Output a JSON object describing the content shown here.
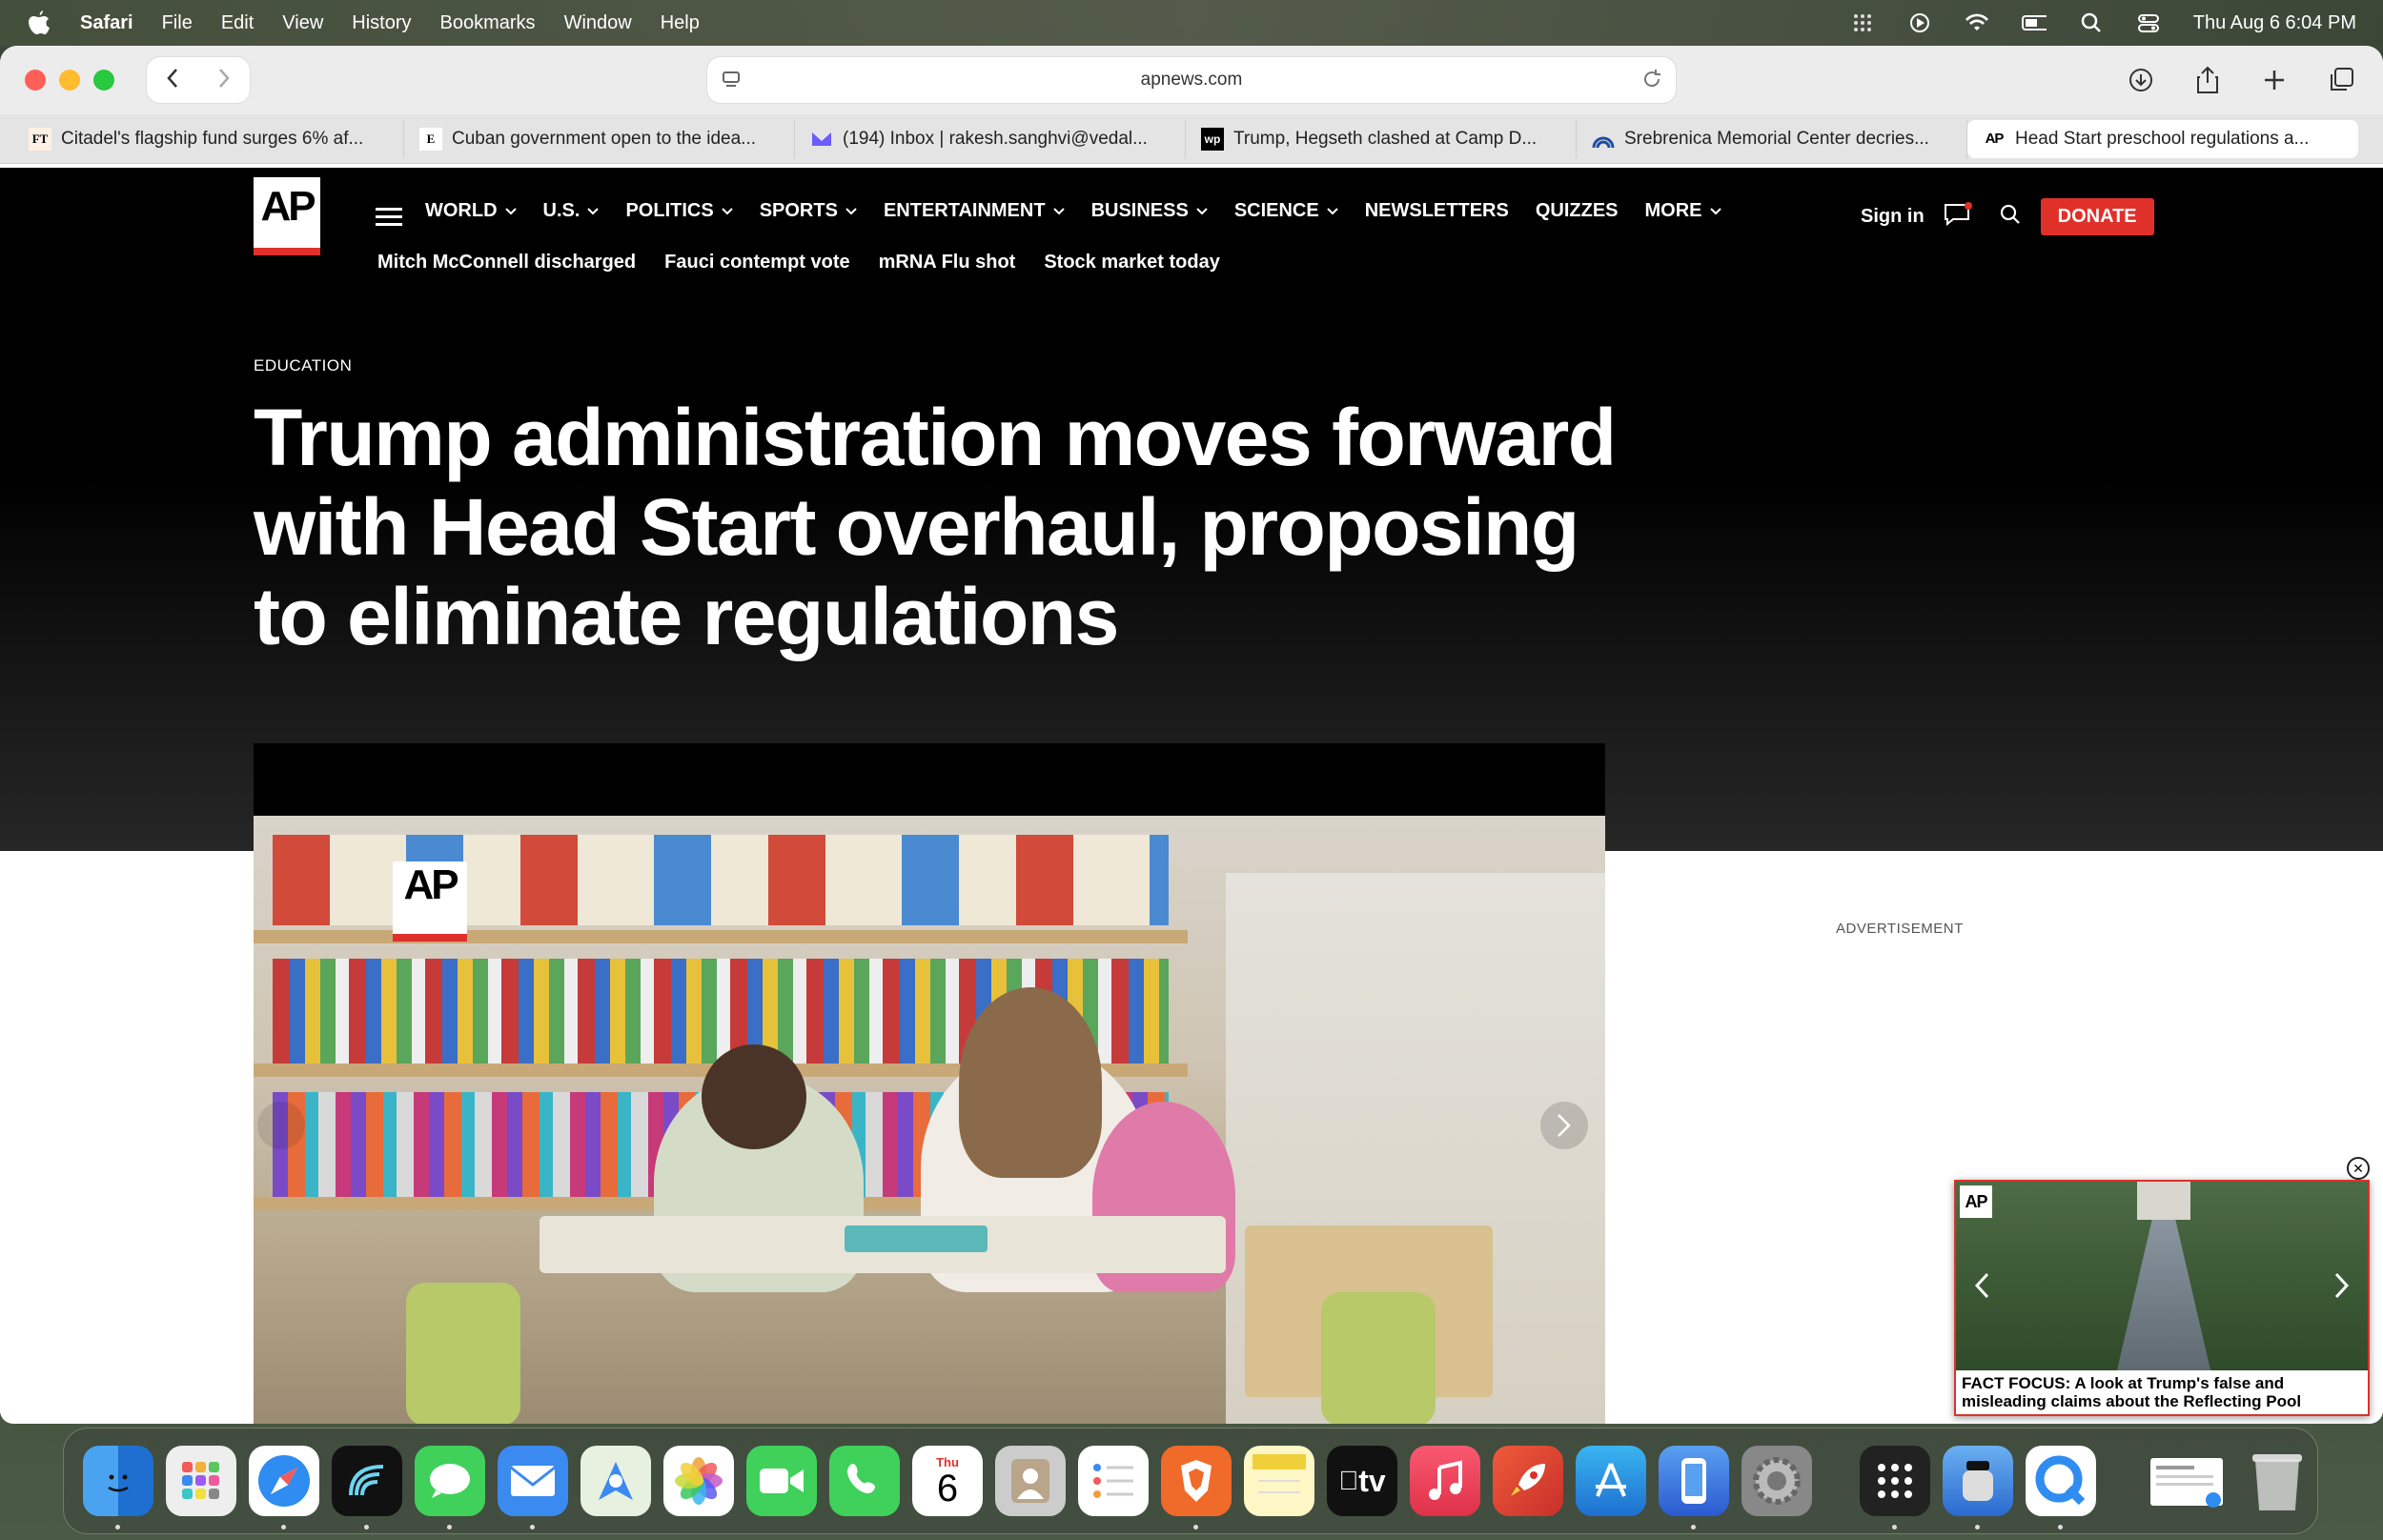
{
  "menubar": {
    "app": "Safari",
    "items": [
      "File",
      "Edit",
      "View",
      "History",
      "Bookmarks",
      "Window",
      "Help"
    ],
    "clock": "Thu Aug 6  6:04 PM"
  },
  "browser": {
    "address": "apnews.com",
    "tabs": [
      {
        "favicon": "FT",
        "title": "Citadel's flagship fund surges 6% af..."
      },
      {
        "favicon": "E",
        "title": "Cuban government open to the idea..."
      },
      {
        "favicon": "M",
        "title": "(194) Inbox | rakesh.sanghvi@vedal..."
      },
      {
        "favicon": "wp",
        "title": "Trump, Hegseth clashed at Camp D..."
      },
      {
        "favicon": "AA",
        "title": "Srebrenica Memorial Center decries..."
      },
      {
        "favicon": "AP",
        "title": "Head Start preschool regulations a..."
      }
    ]
  },
  "site": {
    "logo": "AP",
    "nav": [
      {
        "label": "WORLD",
        "caret": true
      },
      {
        "label": "U.S.",
        "caret": true
      },
      {
        "label": "POLITICS",
        "caret": true
      },
      {
        "label": "SPORTS",
        "caret": true
      },
      {
        "label": "ENTERTAINMENT",
        "caret": true
      },
      {
        "label": "BUSINESS",
        "caret": true
      },
      {
        "label": "SCIENCE",
        "caret": true
      },
      {
        "label": "NEWSLETTERS",
        "caret": false
      },
      {
        "label": "QUIZZES",
        "caret": false
      },
      {
        "label": "MORE",
        "caret": true
      }
    ],
    "subnav": [
      "Mitch McConnell discharged",
      "Fauci contempt vote",
      "mRNA Flu shot",
      "Stock market today"
    ],
    "sign_in": "Sign in",
    "donate": "DONATE"
  },
  "article": {
    "section": "EDUCATION",
    "headline": "Trump administration moves forward with Head Start overhaul, proposing to eliminate regulations",
    "media_logo": "AP"
  },
  "sidebar": {
    "ad_label": "ADVERTISEMENT",
    "pip_logo": "AP",
    "pip_caption": "FACT FOCUS: A look at Trump's false and misleading claims about the Reflecting Pool"
  },
  "dock": {
    "calendar_month": "Thu",
    "calendar_day": "6",
    "tv_label": "tv"
  },
  "colors": {
    "accent": "#e0302a",
    "hero_bg": "#000000"
  }
}
